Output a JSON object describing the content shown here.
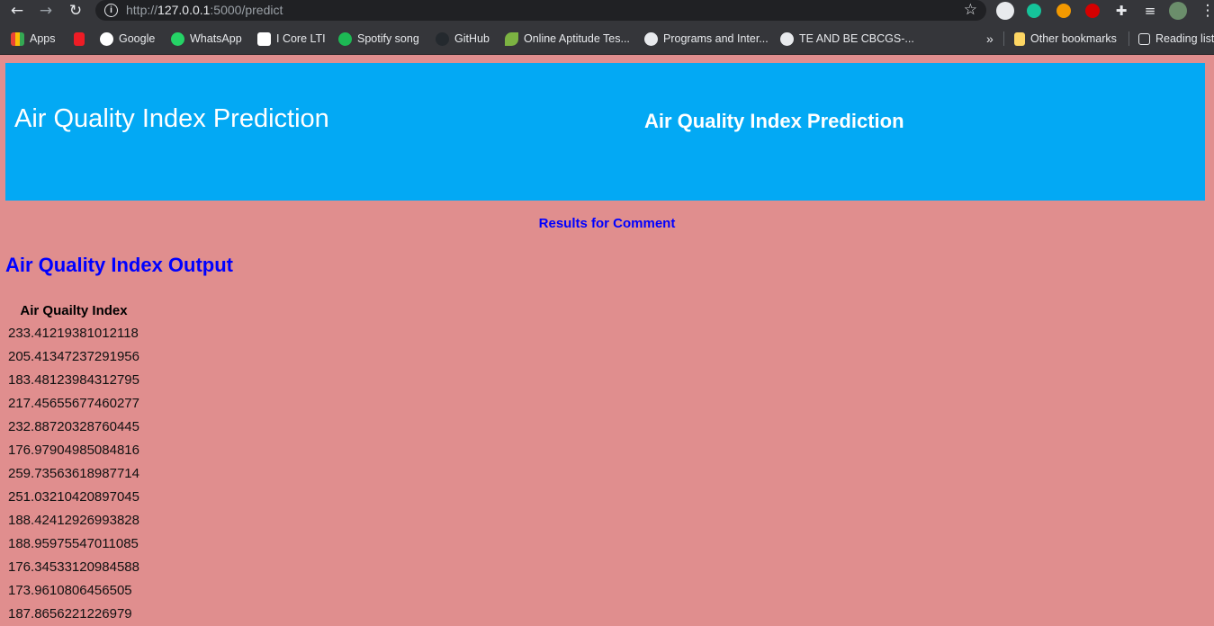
{
  "browser": {
    "url_scheme": "http://",
    "url_host": "127.0.0.1",
    "url_path": ":5000/predict",
    "bookmarks": [
      {
        "label": "Apps",
        "icon": "apps-grid-icon",
        "color": "#ea4335"
      },
      {
        "label": "",
        "icon": "vi-logo-icon",
        "color": "#ee1c25"
      },
      {
        "label": "Google",
        "icon": "google-icon",
        "color": "#ffffff"
      },
      {
        "label": "WhatsApp",
        "icon": "whatsapp-icon",
        "color": "#25d366"
      },
      {
        "label": "I Core LTI",
        "icon": "lti-icon",
        "color": "#ffffff"
      },
      {
        "label": "Spotify song",
        "icon": "spotify-icon",
        "color": "#1db954"
      },
      {
        "label": "GitHub",
        "icon": "github-icon",
        "color": "#24292e"
      },
      {
        "label": "Online Aptitude Tes...",
        "icon": "leaf-icon",
        "color": "#7cb342"
      },
      {
        "label": "Programs and Inter...",
        "icon": "globe-icon",
        "color": "#e8eaed"
      },
      {
        "label": "TE AND BE CBCGS-...",
        "icon": "globe-icon",
        "color": "#e8eaed"
      }
    ],
    "overflow_label": "»",
    "other_bookmarks": "Other bookmarks",
    "reading_list": "Reading list"
  },
  "banner": {
    "title": "Air Quality Index Prediction",
    "subtitle": "Air Quality Index Prediction",
    "color": "#03a9f4"
  },
  "results_link": "Results for Comment",
  "output_title": "Air Quality Index Output",
  "table": {
    "header": "Air Quailty Index",
    "values": [
      "233.41219381012118",
      "205.41347237291956",
      "183.48123984312795",
      "217.45655677460277",
      "232.88720328760445",
      "176.97904985084816",
      "259.73563618987714",
      "251.03210420897045",
      "188.42412926993828",
      "188.95975547011085",
      "176.34533120984588",
      "173.9610806456505",
      "187.8656221226979"
    ]
  }
}
